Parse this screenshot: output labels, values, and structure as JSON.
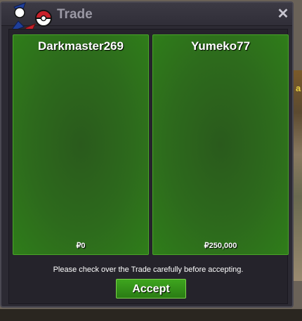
{
  "window": {
    "title": "Trade",
    "close_label": "✕",
    "logo_icon": "pokeball-logo-icon"
  },
  "left_panel": {
    "name": "Darkmaster269",
    "money": "₽0"
  },
  "right_panel": {
    "name": "Yumeko77",
    "money": "₽250,000"
  },
  "message": "Please check over the Trade carefully before accepting.",
  "accept_label": "Accept",
  "background": {
    "right_edge_text": "a"
  },
  "colors": {
    "panel_green": "#2d6a1c",
    "accept_green": "#3ea51e",
    "window_bg": "#2c2a33"
  }
}
